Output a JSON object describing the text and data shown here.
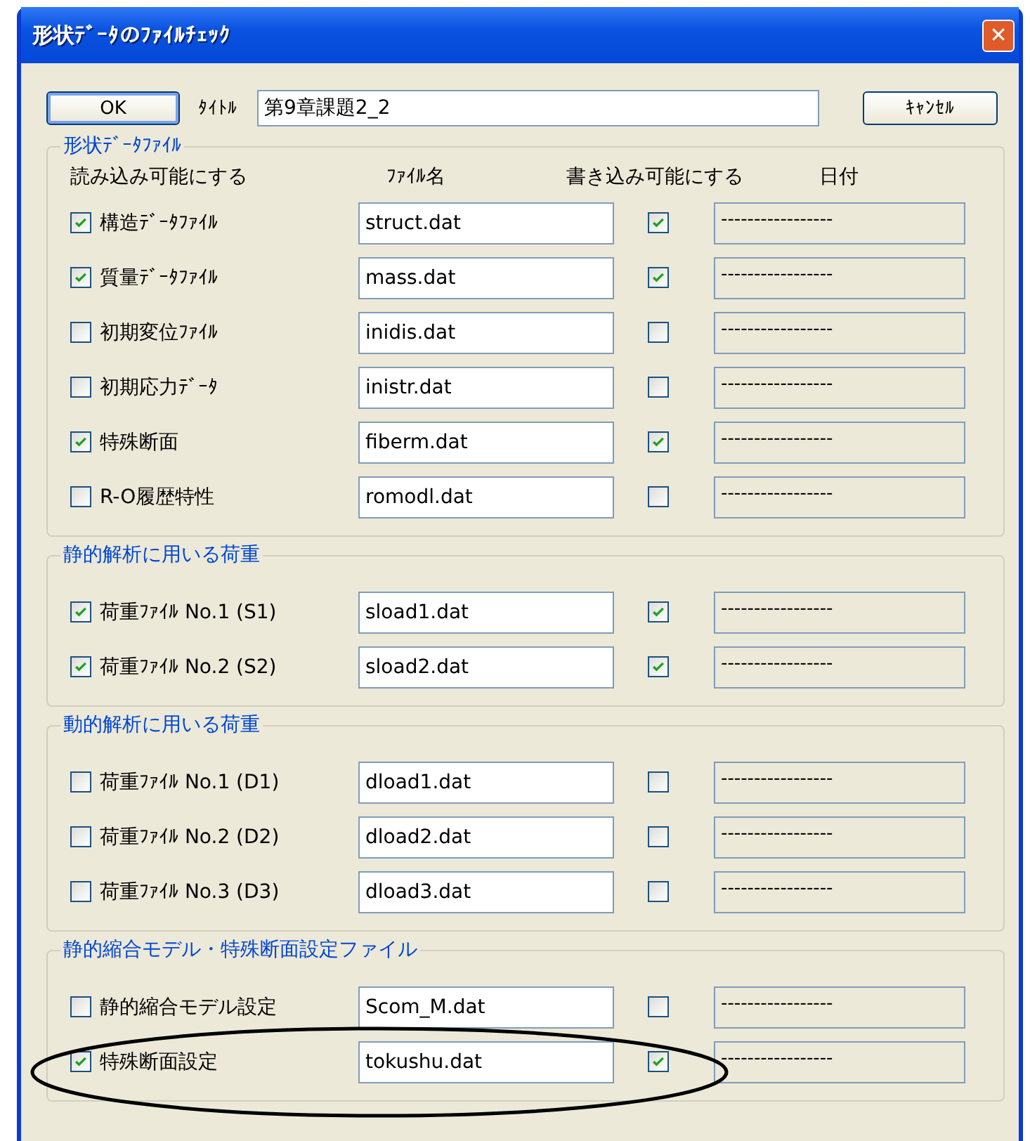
{
  "window": {
    "title": "形状ﾃﾞｰﾀのﾌｧｲﾙﾁｪｯｸ",
    "close": "✕"
  },
  "ok_button": "OK",
  "title_label": "ﾀｲﾄﾙ",
  "title_value": "第9章課題2_2",
  "cancel_button": "ｷｬﾝｾﾙ",
  "sections": [
    {
      "legend": "形状ﾃﾞｰﾀﾌｧｲﾙ",
      "columns": [
        "読み込み可能にする",
        "ﾌｧｲﾙ名",
        "書き込み可能にする",
        "日付"
      ],
      "rows": [
        {
          "label": "構造ﾃﾞｰﾀﾌｧｲﾙ",
          "read_checked": true,
          "filename": "struct.dat",
          "write_checked": true,
          "date": "-----------------",
          "circled": false
        },
        {
          "label": "質量ﾃﾞｰﾀﾌｧｲﾙ",
          "read_checked": true,
          "filename": "mass.dat",
          "write_checked": true,
          "date": "-----------------",
          "circled": false
        },
        {
          "label": "初期変位ﾌｧｲﾙ",
          "read_checked": false,
          "filename": "inidis.dat",
          "write_checked": false,
          "date": "-----------------",
          "circled": false
        },
        {
          "label": "初期応力ﾃﾞｰﾀ",
          "read_checked": false,
          "filename": "inistr.dat",
          "write_checked": false,
          "date": "-----------------",
          "circled": false
        },
        {
          "label": "特殊断面",
          "read_checked": true,
          "filename": "fiberm.dat",
          "write_checked": true,
          "date": "-----------------",
          "circled": false
        },
        {
          "label": "R-O履歴特性",
          "read_checked": false,
          "filename": "romodl.dat",
          "write_checked": false,
          "date": "-----------------",
          "circled": false
        }
      ]
    },
    {
      "legend": "静的解析に用いる荷重",
      "rows": [
        {
          "label": "荷重ﾌｧｲﾙ No.1 (S1)",
          "read_checked": true,
          "filename": "sload1.dat",
          "write_checked": true,
          "date": "-----------------",
          "circled": false
        },
        {
          "label": "荷重ﾌｧｲﾙ No.2 (S2)",
          "read_checked": true,
          "filename": "sload2.dat",
          "write_checked": true,
          "date": "-----------------",
          "circled": false
        }
      ]
    },
    {
      "legend": "動的解析に用いる荷重",
      "rows": [
        {
          "label": "荷重ﾌｧｲﾙ No.1 (D1)",
          "read_checked": false,
          "filename": "dload1.dat",
          "write_checked": false,
          "date": "-----------------",
          "circled": false
        },
        {
          "label": "荷重ﾌｧｲﾙ No.2 (D2)",
          "read_checked": false,
          "filename": "dload2.dat",
          "write_checked": false,
          "date": "-----------------",
          "circled": false
        },
        {
          "label": "荷重ﾌｧｲﾙ No.3 (D3)",
          "read_checked": false,
          "filename": "dload3.dat",
          "write_checked": false,
          "date": "-----------------",
          "circled": false
        }
      ]
    },
    {
      "legend": "静的縮合モデル・特殊断面設定ファイル",
      "rows": [
        {
          "label": "静的縮合モデル設定",
          "read_checked": false,
          "filename": "Scom_M.dat",
          "write_checked": false,
          "date": "-----------------",
          "circled": false
        },
        {
          "label": "特殊断面設定",
          "read_checked": true,
          "filename": "tokushu.dat",
          "write_checked": true,
          "date": "-----------------",
          "circled": true
        }
      ]
    }
  ]
}
